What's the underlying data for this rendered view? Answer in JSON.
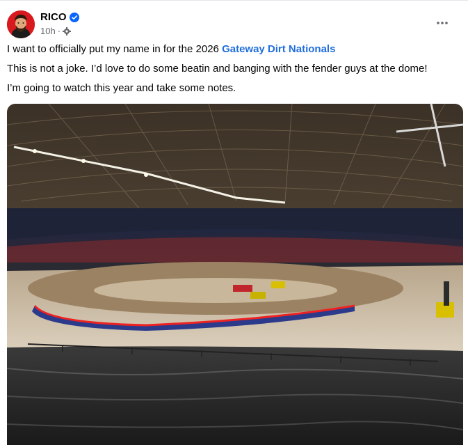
{
  "post": {
    "author": "RICO",
    "time": "10h",
    "separator": "·",
    "line1_text": "I want to officially put my name in for the 2026 ",
    "line1_link": "Gateway Dirt Nationals",
    "line2": "This is not a joke. I’d love to do some beatin and banging with the fender guys at the dome!",
    "line3": "I’m going to watch this year and take some notes."
  },
  "icons": {
    "verified": "verified-badge-icon",
    "audience": "gear-icon",
    "more": "more-options-icon"
  },
  "colors": {
    "link": "#216fdb",
    "verified": "#0866ff",
    "meta": "#65676b",
    "avatar_bg": "#d8191e"
  }
}
